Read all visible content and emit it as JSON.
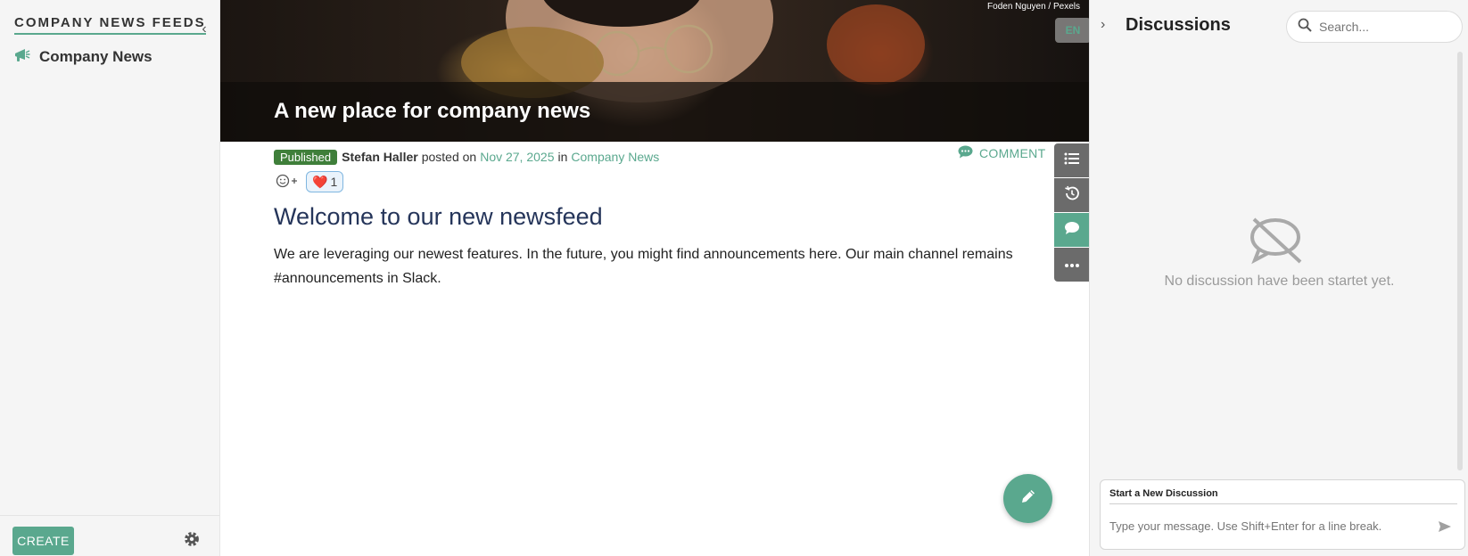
{
  "sidebar": {
    "title": "COMPANY NEWS FEEDS",
    "items": [
      {
        "label": "Company News",
        "icon": "megaphone-icon"
      }
    ],
    "create_label": "CREATE"
  },
  "hero": {
    "title": "A new place for company news",
    "credit": "Foden Nguyen / Pexels",
    "language_badge": "EN"
  },
  "article": {
    "status": "Published",
    "author": "Stefan Haller",
    "posted_on_text": "posted on",
    "date": "Nov 27, 2025",
    "in_text": "in",
    "channel": "Company News",
    "comment_label": "COMMENT",
    "reaction_emoji": "❤️",
    "reaction_count": "1",
    "heading": "Welcome to our new newsfeed",
    "body": "We are leveraging our newest features. In the future, you might find announcements here. Our main channel remains #announcements in Slack."
  },
  "discussions": {
    "title": "Discussions",
    "search_placeholder": "Search...",
    "empty_text": "No discussion have been startet yet.",
    "new_title": "Start a New Discussion",
    "new_placeholder": "Type your message. Use Shift+Enter for a line break."
  },
  "colors": {
    "accent": "#5aa88e",
    "published": "#3f7f3a",
    "heading": "#25355a"
  }
}
